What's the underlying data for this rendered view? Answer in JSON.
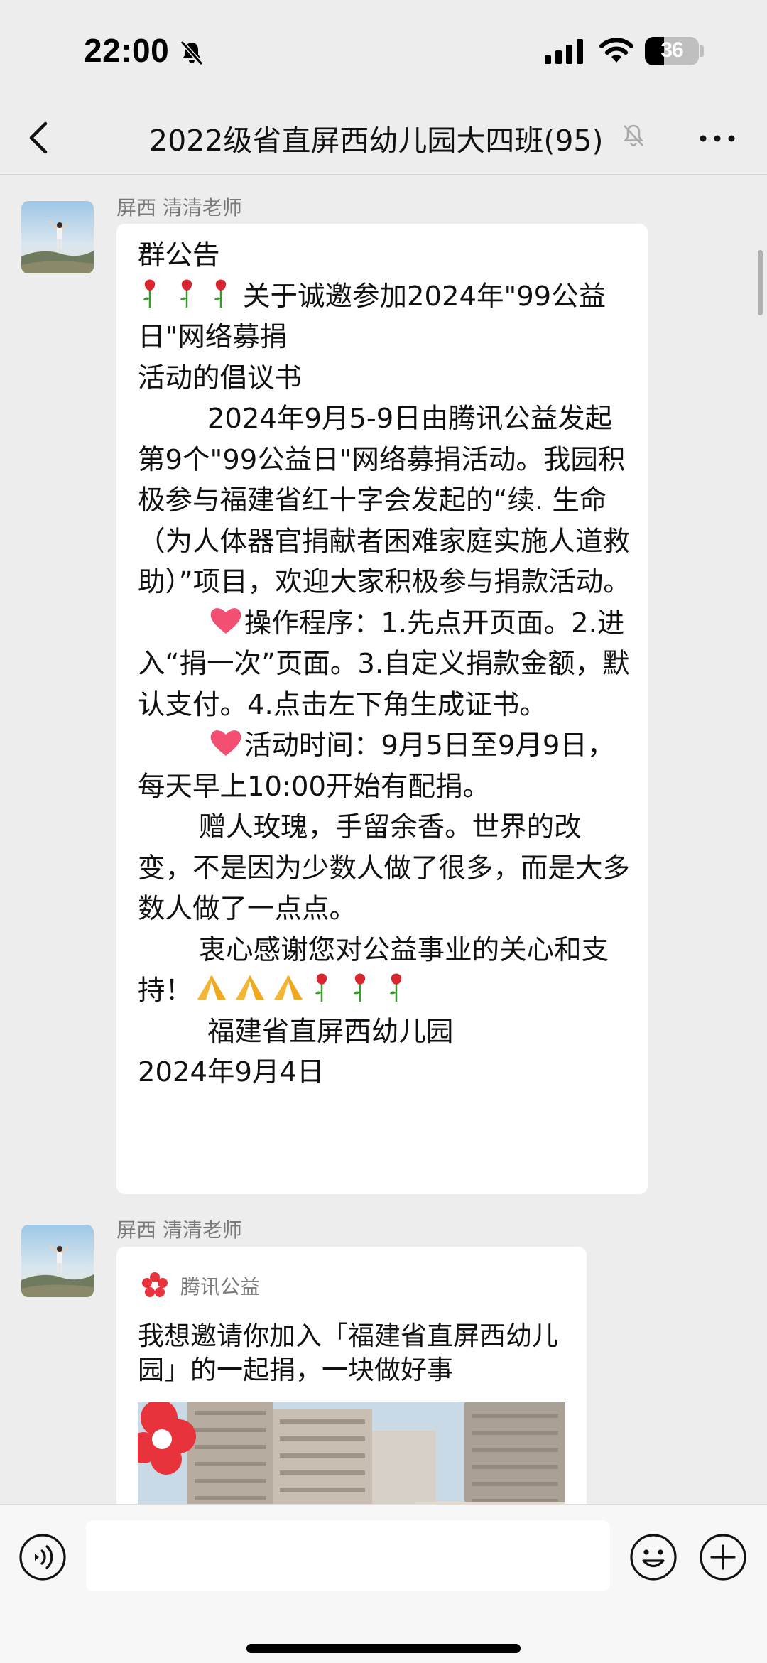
{
  "status_bar": {
    "time": "22:00",
    "battery": "36",
    "battery_level": 0.36
  },
  "header": {
    "title": "2022级省直屏西幼儿园大四班(95)"
  },
  "messages": [
    {
      "sender": "屏西 清清老师",
      "text_before": "群公告\n",
      "line_intro": "关于诚邀参加2024年\"99公益日\"网络募捐\n活动的倡议书\n        2024年9月5-9日由腾讯公益发起第9个\"99公益日\"网络募捐活动。我园积极参与福建省红十字会发起的“续. 生命（为人体器官捐献者困难家庭实施人道救助）”项目，欢迎大家积极参与捐款活动。\n        ",
      "steps": "操作程序：1.先点开页面。2.进入“捐一次”页面。3.自定义捐款金额，默认支付。4.点击左下角生成证书。\n        ",
      "period": "活动时间：9月5日至9月9日，每天早上10:00开始有配捐。\n       赠人玫瑰，手留余香。世界的改变，不是因为少数人做了很多，而是大多数人做了一点点。\n       衷心感谢您对公益事业的关心和支持！",
      "signature": "\n        福建省直屏西幼儿园\n2024年9月4日"
    },
    {
      "sender": "屏西 清清老师",
      "share_source": "腾讯公益",
      "share_title": "我想邀请你加入「福建省直屏西幼儿园」的一起捐，一块做好事"
    }
  ]
}
